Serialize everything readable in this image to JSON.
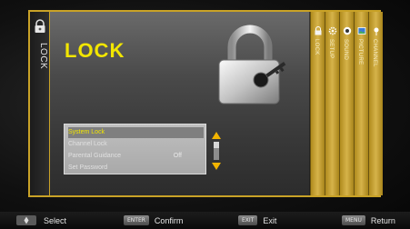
{
  "page": {
    "title": "LOCK",
    "left_tab_label": "LOCK"
  },
  "right_tabs": [
    {
      "label": "LOCK",
      "icon": "lock-icon"
    },
    {
      "label": "SETUP",
      "icon": "gear-icon"
    },
    {
      "label": "SOUND",
      "icon": "speaker-icon"
    },
    {
      "label": "PICTURE",
      "icon": "picture-icon"
    },
    {
      "label": "CHANNEL",
      "icon": "antenna-icon"
    }
  ],
  "menu": {
    "items": [
      {
        "label": "System Lock",
        "value": "",
        "selected": true
      },
      {
        "label": "Channel Lock",
        "value": "",
        "selected": false
      },
      {
        "label": "Parental Guidance",
        "value": "Off",
        "selected": false
      },
      {
        "label": "Set Password",
        "value": "",
        "selected": false
      }
    ]
  },
  "hints": [
    {
      "key": "",
      "label": "Select",
      "icon": "dpad-icon"
    },
    {
      "key": "ENTER",
      "label": "Confirm"
    },
    {
      "key": "EXIT",
      "label": "Exit"
    },
    {
      "key": "MENU",
      "label": "Return"
    }
  ],
  "colors": {
    "accent_gold": "#c9a227",
    "title_yellow": "#f2e600",
    "panel_gray": "#4a4a4a"
  }
}
